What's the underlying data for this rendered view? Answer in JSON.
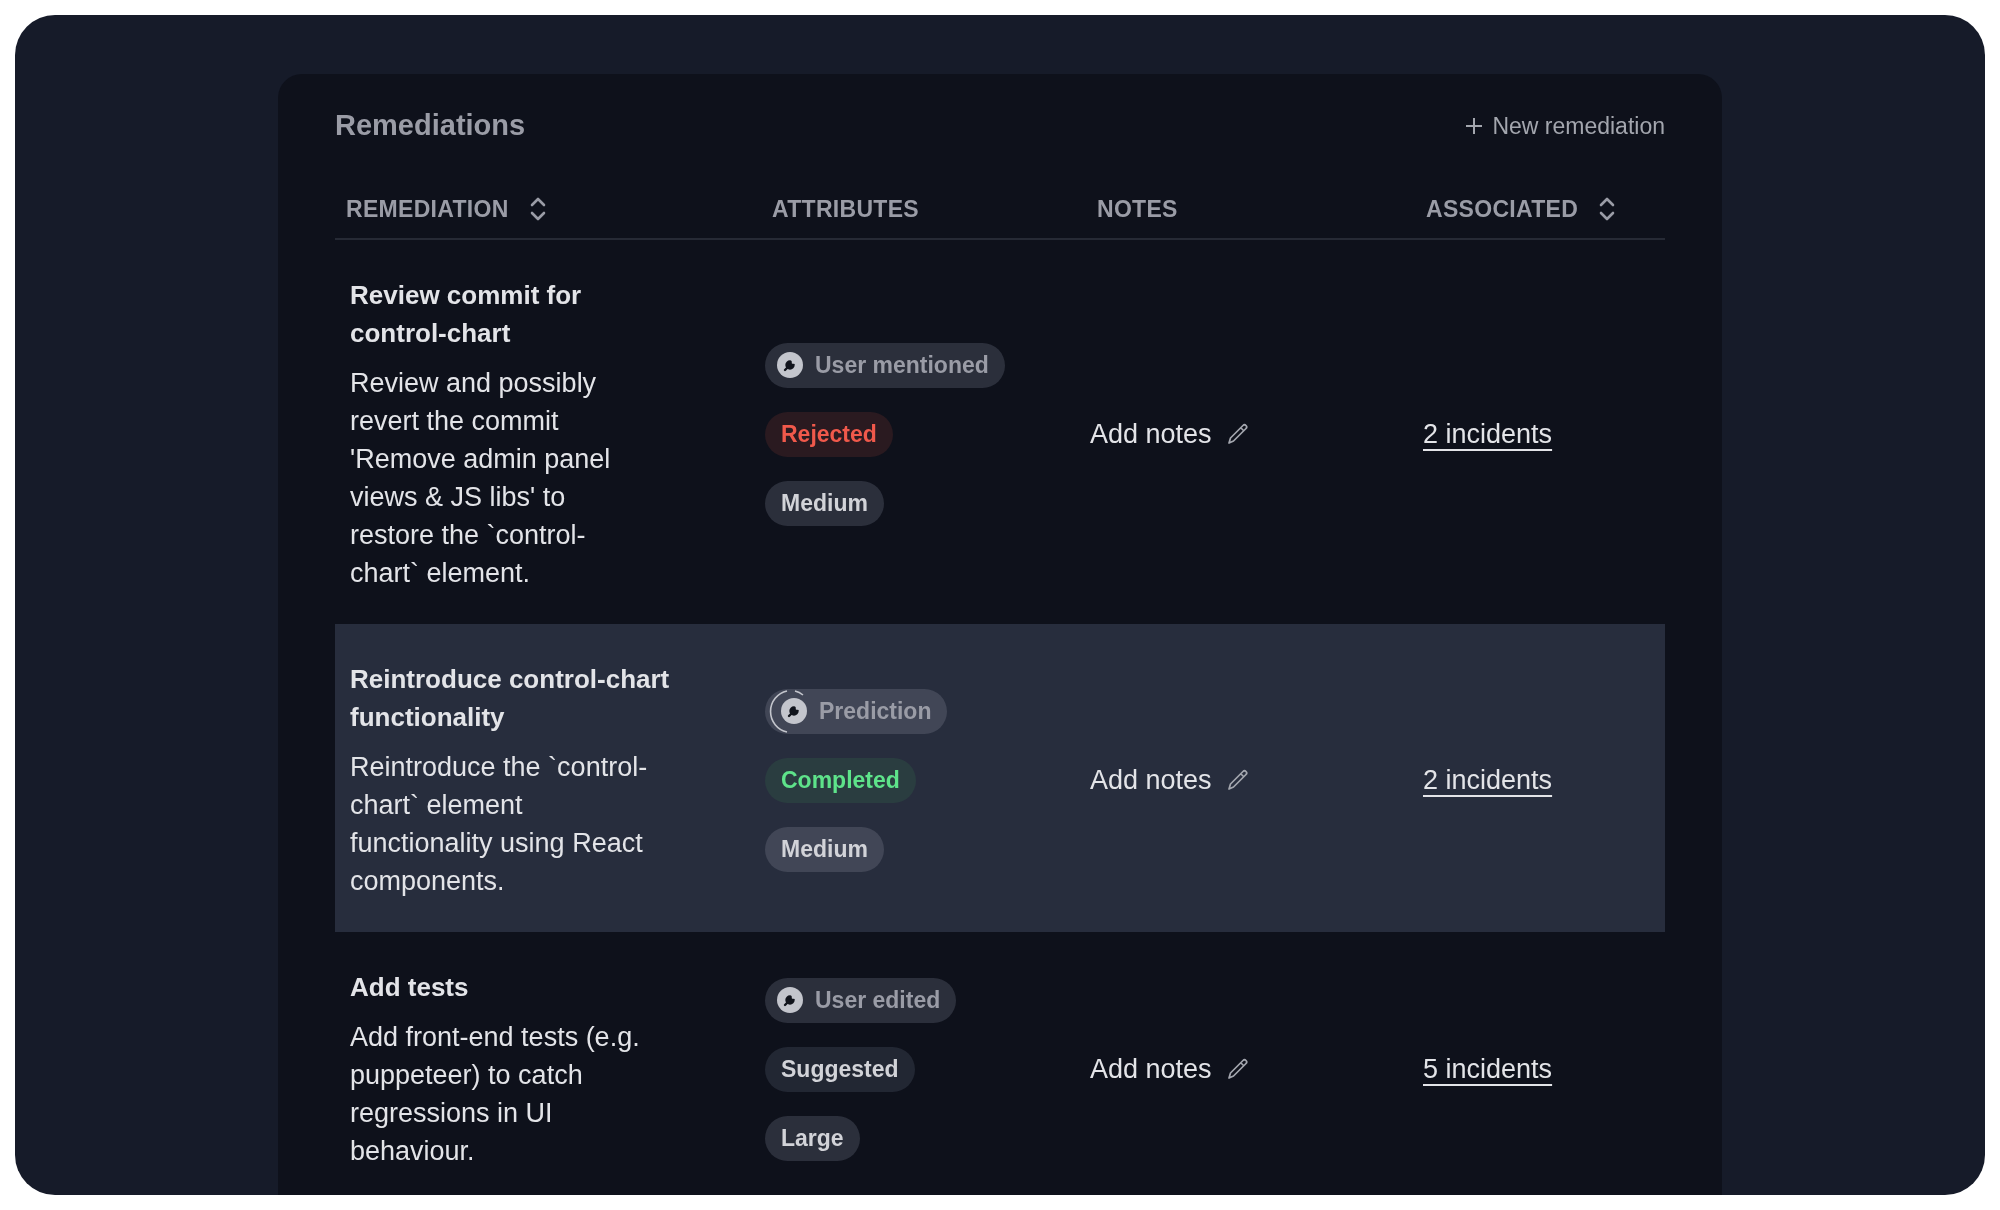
{
  "panel": {
    "title": "Remediations",
    "new_button": "New remediation"
  },
  "table": {
    "columns": [
      {
        "label": "REMEDIATION",
        "sortable": true
      },
      {
        "label": "ATTRIBUTES",
        "sortable": false
      },
      {
        "label": "NOTES",
        "sortable": false
      },
      {
        "label": "ASSOCIATED",
        "sortable": true
      }
    ],
    "rows": [
      {
        "selected": false,
        "title": "Review commit for control-chart",
        "description": "Review and possibly revert the commit 'Remove admin panel views & JS libs' to restore the `control-chart` element.",
        "source": {
          "label": "User mentioned",
          "loading": false
        },
        "status": {
          "label": "Rejected",
          "color": "#f0594b"
        },
        "size": "Medium",
        "notes": "Add notes",
        "associated": "2 incidents"
      },
      {
        "selected": true,
        "title": "Reintroduce control-chart functionality",
        "description": "Reintroduce the `control-chart` element functionality using React components.",
        "source": {
          "label": "Prediction",
          "loading": true
        },
        "status": {
          "label": "Completed",
          "color": "#5ee38a"
        },
        "size": "Medium",
        "notes": "Add notes",
        "associated": "2 incidents"
      },
      {
        "selected": false,
        "title": "Add tests",
        "description": "Add front-end tests (e.g. puppeteer) to catch regressions in UI behaviour.",
        "source": {
          "label": "User edited",
          "loading": false
        },
        "status": {
          "label": "Suggested",
          "color": "#d2d3d8"
        },
        "size": "Large",
        "notes": "Add notes",
        "associated": "5 incidents"
      }
    ]
  }
}
